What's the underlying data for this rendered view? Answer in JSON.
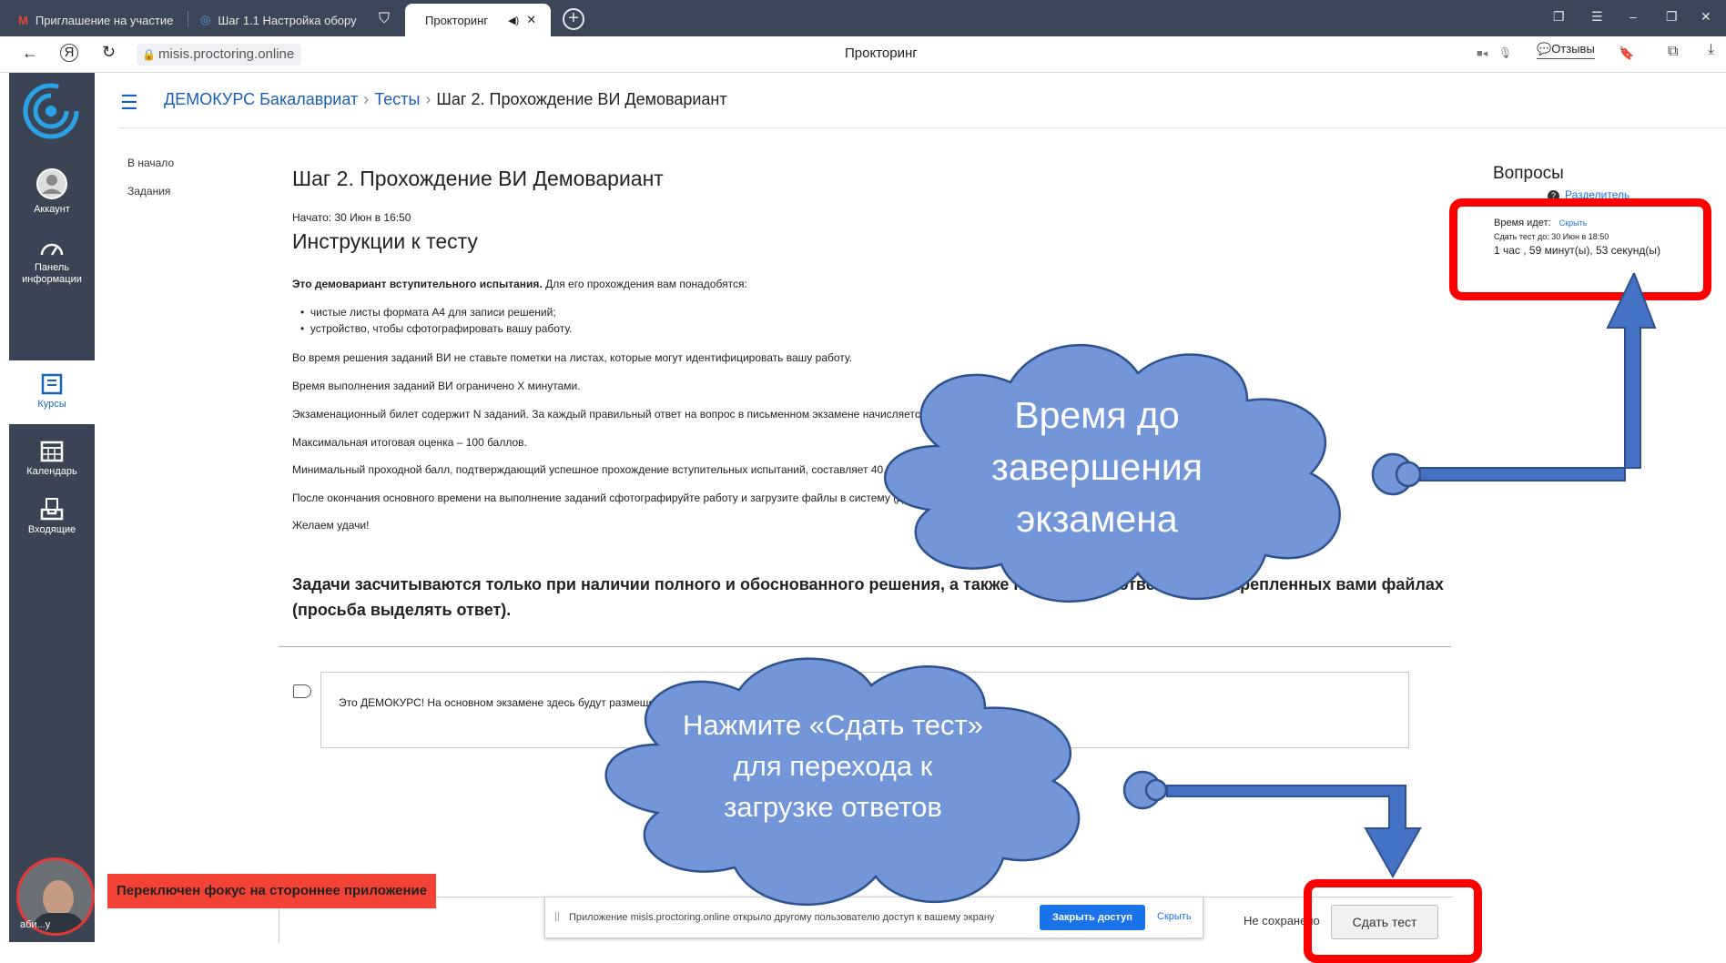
{
  "browser": {
    "tabs": [
      {
        "label": "Приглашение на участие"
      },
      {
        "label": "Шаг 1.1 Настройка обору"
      },
      {
        "label": "Прокторинг"
      }
    ],
    "url": "misis.proctoring.online",
    "page_title": "Прокторинг",
    "feedback_label": "Отзывы"
  },
  "sidebar": {
    "items": [
      {
        "label": "Аккаунт",
        "icon": "user-icon"
      },
      {
        "label": "Панель информации",
        "icon": "dashboard-icon"
      },
      {
        "label": "Курсы",
        "icon": "courses-icon"
      },
      {
        "label": "Календарь",
        "icon": "calendar-icon"
      },
      {
        "label": "Входящие",
        "icon": "inbox-icon"
      }
    ],
    "avatar_caption": "аби...у"
  },
  "breadcrumb": {
    "items": [
      "ДЕМОКУРС Бакалавриат",
      "Тесты",
      "Шаг 2. Прохождение ВИ Демовариант"
    ]
  },
  "left_links": [
    "В начало",
    "Задания"
  ],
  "content": {
    "title": "Шаг 2. Прохождение ВИ Демовариант",
    "started": "Начато: 30 Июн в 16:50",
    "instructions_title": "Инструкции к тесту",
    "intro_bold": "Это демовариант вступительного испытания.",
    "intro_rest": " Для его прохождения вам понадобятся:",
    "bullets": [
      "чистые листы формата А4 для записи решений;",
      "устройство, чтобы сфотографировать вашу работу."
    ],
    "paragraphs": [
      " Во время решения заданий ВИ не ставьте пометки на листах, которые могут идентифицировать вашу работу.",
      "Время выполнения заданий ВИ ограничено X минутами.",
      "Экзаменационный билет содержит N заданий. За каждый правильный ответ на вопрос в письменном экзамене начисляется Y баллов.",
      "Максимальная итоговая оценка – 100 баллов.",
      "Минимальный проходной балл, подтверждающий успешное прохождение вступительных испытаний, составляет 40.",
      "После окончания основного времени на выполнение заданий сфотографируйте работу и загрузите файлы в систему (для этого перейдите на Шаг 3).",
      "Желаем удачи!"
    ],
    "bold_notice": "Задачи засчитываются только при наличии полного и обоснованного решения, а также написанных ответов в прикрепленных вами файлах (просьба выделять ответ).",
    "question_text": "Это ДЕМОКУРС!  На основном экзамене здесь будут размещены задания."
  },
  "right_panel": {
    "questions_title": "Вопросы",
    "divider_link": "Разделитель",
    "time_label": "Время идет:",
    "hide_link": "Скрыть",
    "deadline": "Сдать тест до: 30 Июн в 18:50",
    "remaining": "1 час , 59 минут(ы), 53 секунд(ы)"
  },
  "bottom": {
    "share_text": "Приложение misis.proctoring.online открыло другому пользователю доступ к вашему экрану",
    "close_access": "Закрыть доступ",
    "hide": "Скрыть",
    "not_saved": "Не сохранено",
    "submit": "Сдать тест",
    "warning": "Переключен фокус на стороннее приложение"
  },
  "callouts": {
    "timer": [
      "Время до",
      "завершения",
      "экзамена"
    ],
    "submit": [
      "Нажмите «Сдать тест»",
      "для перехода к",
      "загрузке ответов"
    ]
  },
  "colors": {
    "accent": "#1a73e8",
    "sidebar": "#3b4454",
    "highlight": "#ff0000",
    "cloud": "#7296d8"
  }
}
